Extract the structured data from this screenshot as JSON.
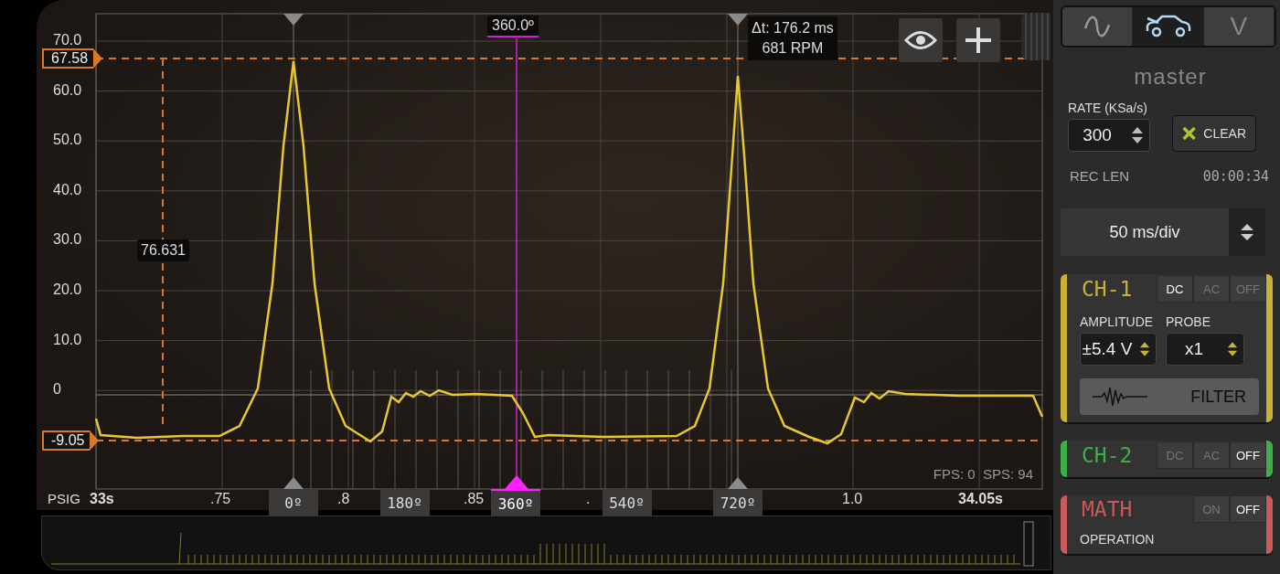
{
  "plot": {
    "y_axis_labels": [
      "70.0",
      "60.0",
      "50.0",
      "40.0",
      "30.0",
      "20.0",
      "10.0",
      "0"
    ],
    "level_tags": [
      {
        "text": "67.58"
      },
      {
        "text": "-9.05"
      }
    ],
    "cursor_value": "76.631",
    "phase_cursor": "360.0º",
    "delta": {
      "time": "Δt: 176.2 ms",
      "rpm": "681 RPM"
    },
    "degree_markers": [
      {
        "label": "0º",
        "selected": false
      },
      {
        "label": "180º",
        "selected": false
      },
      {
        "label": "360º",
        "selected": true
      },
      {
        "label": "540º",
        "selected": false
      },
      {
        "label": "720º",
        "selected": false
      }
    ],
    "unit": "PSIG",
    "start": "33s",
    "x_axis_labels": [
      ".75",
      ".8",
      ".85",
      ".",
      "1.0"
    ],
    "end": "34.05s",
    "stats": "FPS: 0  SPS: 94"
  },
  "modes": [
    {
      "kind": "sine",
      "selected": false
    },
    {
      "kind": "car",
      "selected": true
    },
    {
      "kind": "text",
      "label": "V",
      "selected": false
    }
  ],
  "panel": {
    "title": "master",
    "rate_label": "RATE (KSa/s)",
    "rate": "300",
    "clear": "CLEAR",
    "rec_len_label": "REC LEN",
    "rec_len": "00:00:34",
    "timebase": "50 ms/div"
  },
  "channels": [
    {
      "kind": "channel",
      "name": "CH-1",
      "color": "#c9b037",
      "modes": [
        {
          "label": "DC",
          "selected": true
        },
        {
          "label": "AC",
          "selected": false
        },
        {
          "label": "OFF",
          "selected": false
        }
      ],
      "amplitude_label": "AMPLITUDE",
      "amplitude": "±5.4 V",
      "probe_label": "PROBE",
      "probe": "x1",
      "filter": "FILTER"
    },
    {
      "kind": "channel",
      "name": "CH-2",
      "color": "#3fae4a",
      "modes": [
        {
          "label": "DC",
          "selected": false
        },
        {
          "label": "AC",
          "selected": false
        },
        {
          "label": "OFF",
          "selected": true
        }
      ]
    },
    {
      "kind": "math",
      "name": "MATH",
      "color": "#c85a5a",
      "modes": [
        {
          "label": "ON",
          "selected": false
        },
        {
          "label": "OFF",
          "selected": true
        }
      ],
      "operation_label": "OPERATION"
    }
  ]
}
